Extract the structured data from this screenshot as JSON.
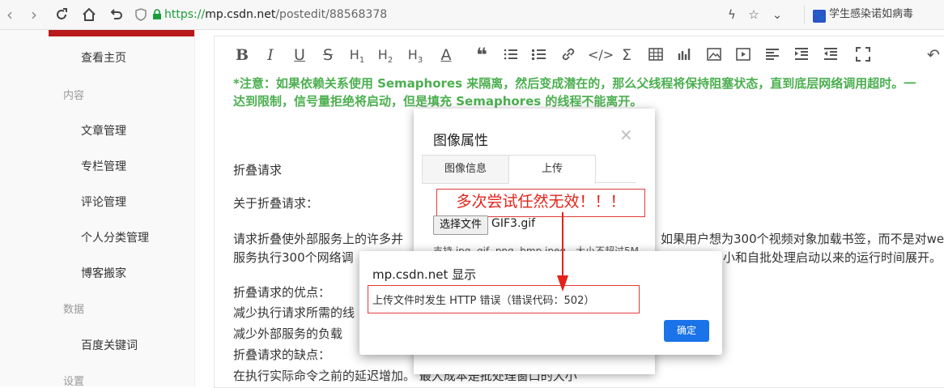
{
  "browser": {
    "url_scheme": "https://",
    "url_host": "mp.csdn.net",
    "url_path": "/postedit/88568378",
    "bookmark": "学生感染诺如病毒",
    "bookmark_icon": "百度"
  },
  "sidebar": {
    "items": [
      {
        "label": "查看主页"
      },
      {
        "group": "内容"
      },
      {
        "label": "文章管理"
      },
      {
        "label": "专栏管理"
      },
      {
        "label": "评论管理"
      },
      {
        "label": "个人分类管理"
      },
      {
        "label": "博客搬家"
      },
      {
        "group": "数据"
      },
      {
        "label": "百度关键词"
      },
      {
        "group": "设置"
      }
    ]
  },
  "editor": {
    "note_line1": "*注意：如果依赖关系使用 Semaphores 来隔离，然后变成潜在的，那么父线程将保持阻塞状态，直到底层网络调用超时。一",
    "note_line2": "达到限制，信号量拒绝将启动，但是填充 Semaphores 的线程不能离开。",
    "heading": "折叠请求",
    "about": "关于折叠请求：",
    "p1_line1_a": "请求折叠使外部服务上的许多并",
    "p1_line1_b": "如果用户想为300个视频对象加载书签，而不是对we",
    "p1_line2_a": "服务执行300个网络调",
    "p1_line2_b": "小和自批处理启动以来的运行时间展开。",
    "pros": "折叠请求的优点：",
    "pro1": "减少执行请求所需的线",
    "pro2": "减少外部服务的负载",
    "cons": "折叠请求的缺点：",
    "con1": "在执行实际命令之前的延迟增加。 最大成本是批处理窗口的大小"
  },
  "image_dialog": {
    "title": "图像属性",
    "close": "×",
    "tab_info": "图像信息",
    "tab_upload": "上传",
    "annotation": "多次尝试任然无效！！！",
    "choose_file": "选择文件",
    "filename": "GIF3.gif",
    "hint": "支持 jpg, gif, png, bmp,jpeg，大小不超过5M"
  },
  "alert": {
    "title": "mp.csdn.net 显示",
    "message": "上传文件时发生 HTTP 错误（错误代码：502）",
    "ok": "确定"
  },
  "colors": {
    "accent_red": "#e2231a",
    "note_green": "#4caf50",
    "ok_blue": "#1a73e8",
    "sidebar_top": "#b8191b"
  }
}
